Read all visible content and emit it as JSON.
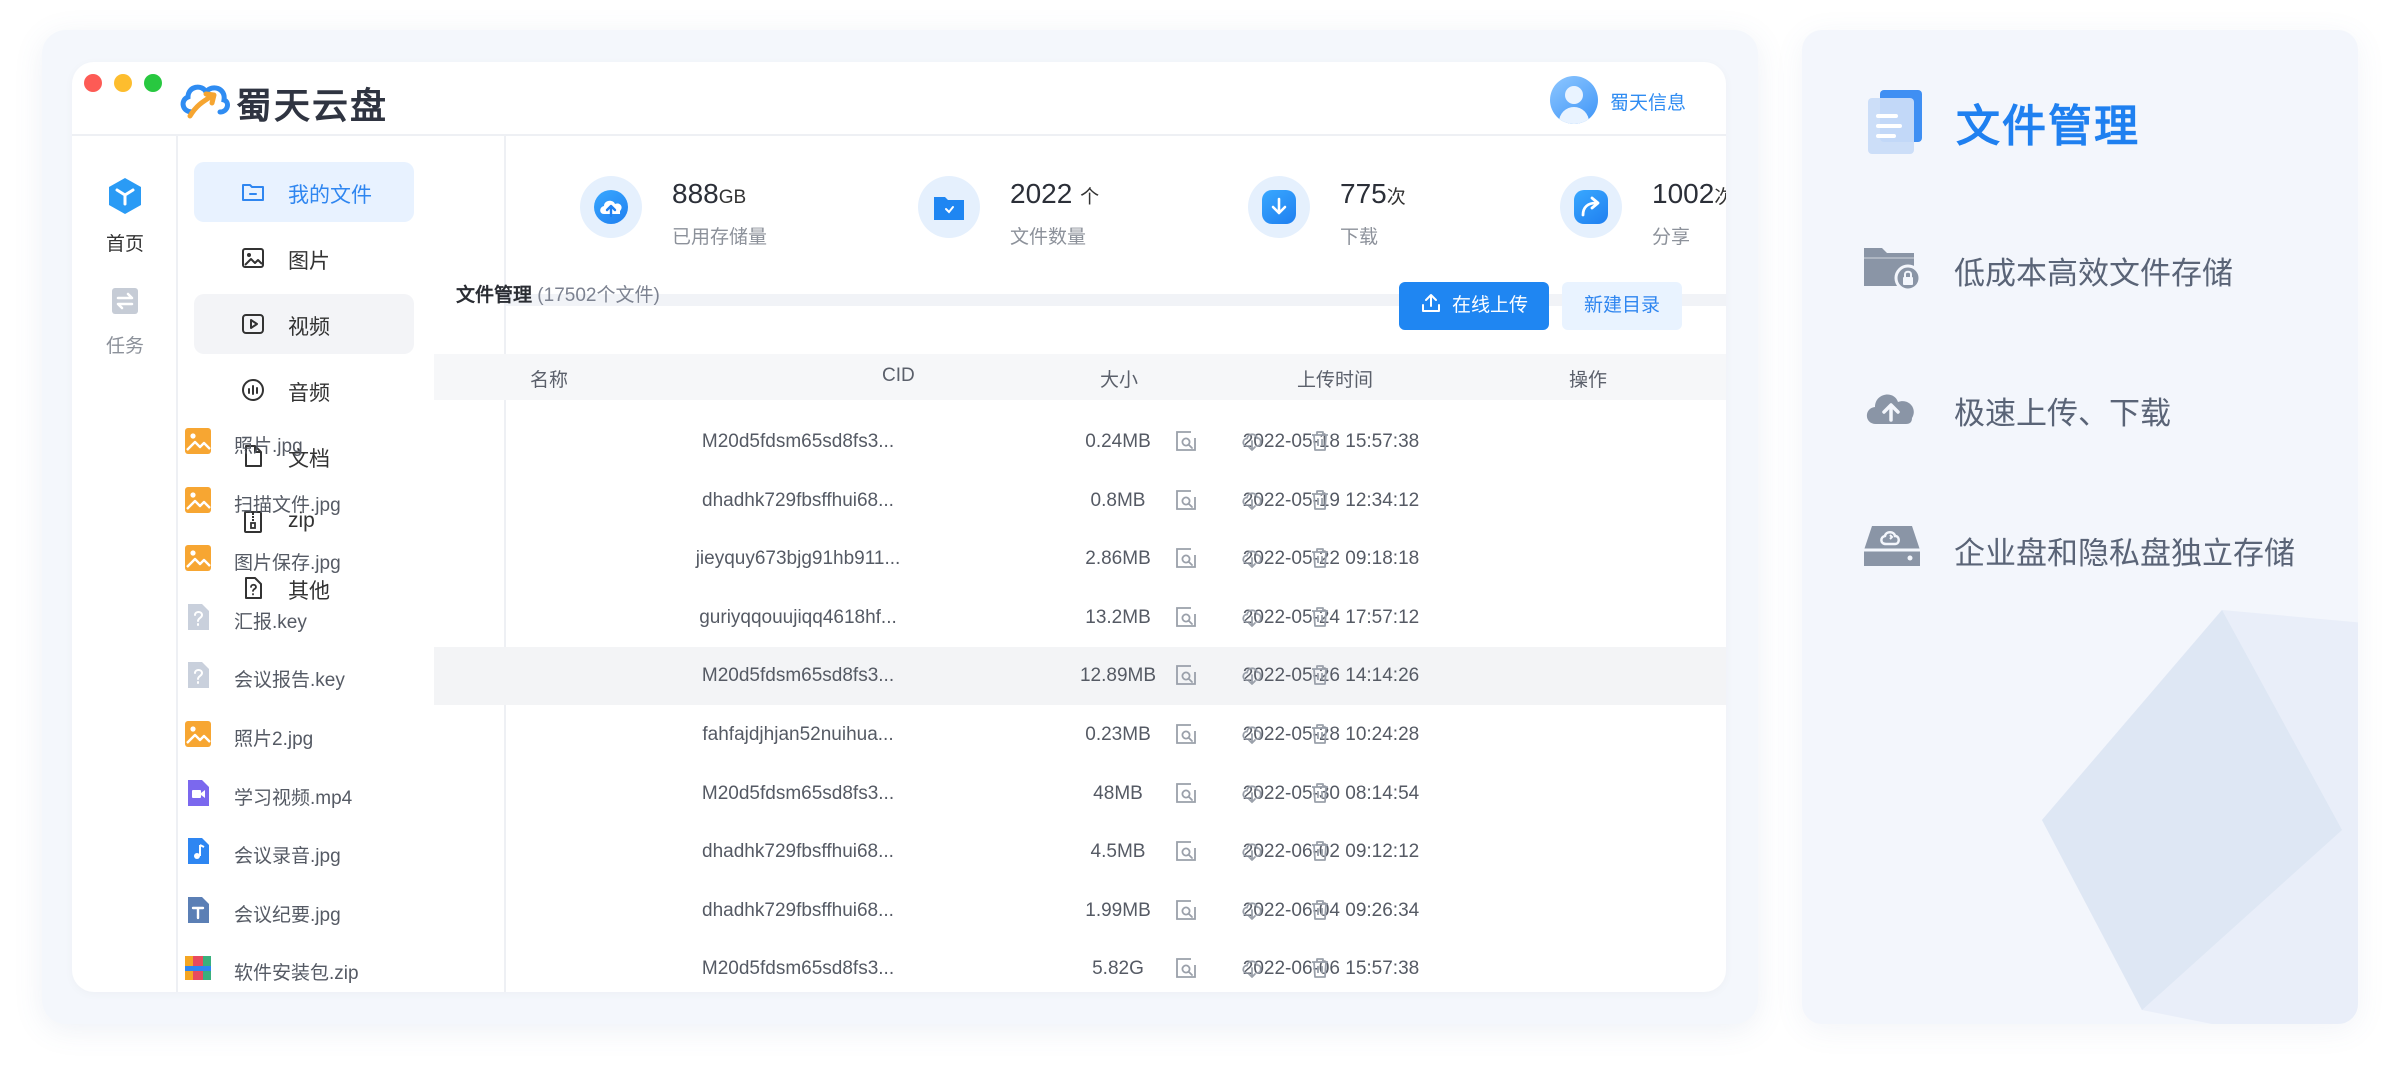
{
  "brand": {
    "name": "蜀天云盘"
  },
  "user": {
    "name": "蜀天信息"
  },
  "rail": [
    {
      "label": "首页"
    },
    {
      "label": "任务"
    }
  ],
  "sidebar": {
    "items": [
      {
        "label": "我的文件",
        "icon": "folder-icon"
      },
      {
        "label": "图片",
        "icon": "image-icon"
      },
      {
        "label": "视频",
        "icon": "video-icon"
      },
      {
        "label": "音频",
        "icon": "audio-icon"
      },
      {
        "label": "文档",
        "icon": "document-icon"
      },
      {
        "label": "zip",
        "icon": "zip-icon"
      },
      {
        "label": "其他",
        "icon": "other-file-icon"
      }
    ]
  },
  "stats": [
    {
      "value": "888",
      "unit": "GB",
      "label": "已用存储量",
      "icon": "cloud-upload-icon"
    },
    {
      "value": "2022",
      "unit": "个",
      "label": "文件数量",
      "icon": "folder-icon"
    },
    {
      "value": "775",
      "unit": "次",
      "label": "下载",
      "icon": "download-icon"
    },
    {
      "value": "1002",
      "unit": "次",
      "label": "分享",
      "icon": "share-icon"
    }
  ],
  "files": {
    "title": "文件管理",
    "count": "(17502个文件)",
    "upload_label": "在线上传",
    "new_dir_label": "新建目录",
    "columns": [
      "名称",
      "CID",
      "大小",
      "上传时间",
      "操作"
    ],
    "rows": [
      {
        "name": "照片.jpg",
        "type": "image",
        "cid": "M20d5fdsm65sd8fs3...",
        "size": "0.24MB",
        "time": "2022-05-18 15:57:38"
      },
      {
        "name": "扫描文件.jpg",
        "type": "image",
        "cid": "dhadhk729fbsffhui68...",
        "size": "0.8MB",
        "time": "2022-05-19 12:34:12"
      },
      {
        "name": "图片保存.jpg",
        "type": "image",
        "cid": "jieyquy673bjg91hb911...",
        "size": "2.86MB",
        "time": "2022-05-22 09:18:18"
      },
      {
        "name": "汇报.key",
        "type": "unknown",
        "cid": "guriyqqouujiqq4618hf...",
        "size": "13.2MB",
        "time": "2022-05-24 17:57:12"
      },
      {
        "name": "会议报告.key",
        "type": "unknown",
        "cid": "M20d5fdsm65sd8fs3...",
        "size": "12.89MB",
        "time": "2022-05-26 14:14:26"
      },
      {
        "name": "照片2.jpg",
        "type": "image",
        "cid": "fahfajdjhjan52nuihua...",
        "size": "0.23MB",
        "time": "2022-05-28 10:24:28"
      },
      {
        "name": "学习视频.mp4",
        "type": "video",
        "cid": "M20d5fdsm65sd8fs3...",
        "size": "48MB",
        "time": "2022-05-30 08:14:54"
      },
      {
        "name": "会议录音.jpg",
        "type": "audio",
        "cid": "dhadhk729fbsffhui68...",
        "size": "4.5MB",
        "time": "2022-06-02 09:12:12"
      },
      {
        "name": "会议纪要.jpg",
        "type": "text",
        "cid": "dhadhk729fbsffhui68...",
        "size": "1.99MB",
        "time": "2022-06-04 09:26:34"
      },
      {
        "name": "软件安装包.zip",
        "type": "zip",
        "cid": "M20d5fdsm65sd8fs3...",
        "size": "5.82G",
        "time": "2022-06-06 15:57:38"
      }
    ],
    "actions": [
      "preview-icon",
      "download-icon",
      "delete-icon"
    ]
  },
  "panel": {
    "title": "文件管理",
    "features": [
      {
        "label": "低成本高效文件存储",
        "icon": "folder-lock-icon"
      },
      {
        "label": "极速上传、下载",
        "icon": "cloud-upload-icon"
      },
      {
        "label": "企业盘和隐私盘独立存储",
        "icon": "disk-drive-icon"
      }
    ]
  },
  "colors": {
    "accent": "#1f86f2",
    "active_bg": "#e8f2ff",
    "panel_bg": "#f3f6fc"
  }
}
